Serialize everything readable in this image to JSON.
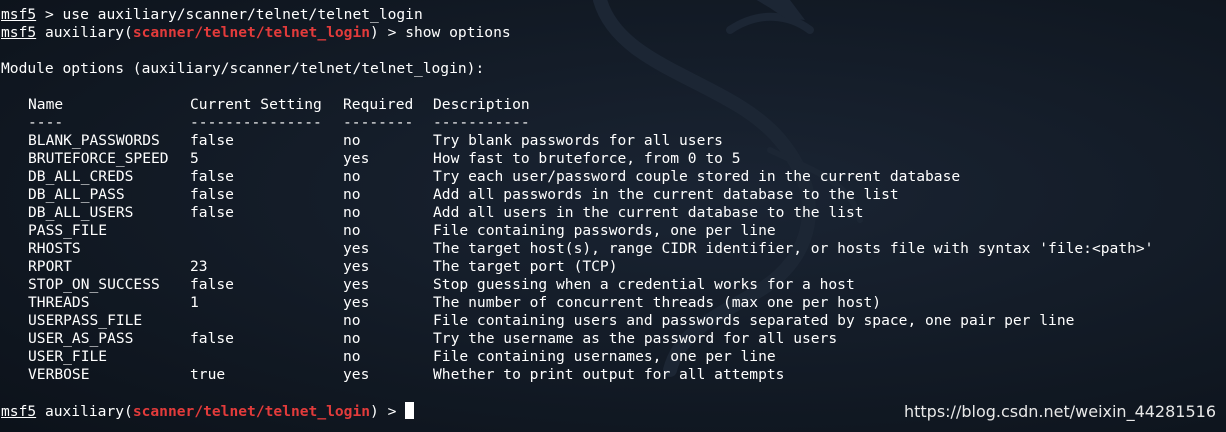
{
  "terminal": {
    "prompt": "msf5",
    "line1_command": " > use auxiliary/scanner/telnet/telnet_login",
    "module_prefix": " auxiliary(",
    "module_name": "scanner/telnet/telnet_login",
    "module_suffix": ") > ",
    "line2_command": "show options",
    "module_options_header": "Module options (auxiliary/scanner/telnet/telnet_login):",
    "columns": [
      "Name",
      "Current Setting",
      "Required",
      "Description"
    ],
    "separators": [
      "----",
      "---------------",
      "--------",
      "-----------"
    ],
    "rows": [
      {
        "name": "BLANK_PASSWORDS",
        "setting": "false",
        "required": "no",
        "description": "Try blank passwords for all users"
      },
      {
        "name": "BRUTEFORCE_SPEED",
        "setting": "5",
        "required": "yes",
        "description": "How fast to bruteforce, from 0 to 5"
      },
      {
        "name": "DB_ALL_CREDS",
        "setting": "false",
        "required": "no",
        "description": "Try each user/password couple stored in the current database"
      },
      {
        "name": "DB_ALL_PASS",
        "setting": "false",
        "required": "no",
        "description": "Add all passwords in the current database to the list"
      },
      {
        "name": "DB_ALL_USERS",
        "setting": "false",
        "required": "no",
        "description": "Add all users in the current database to the list"
      },
      {
        "name": "PASS_FILE",
        "setting": "",
        "required": "no",
        "description": "File containing passwords, one per line"
      },
      {
        "name": "RHOSTS",
        "setting": "",
        "required": "yes",
        "description": "The target host(s), range CIDR identifier, or hosts file with syntax 'file:<path>'"
      },
      {
        "name": "RPORT",
        "setting": "23",
        "required": "yes",
        "description": "The target port (TCP)"
      },
      {
        "name": "STOP_ON_SUCCESS",
        "setting": "false",
        "required": "yes",
        "description": "Stop guessing when a credential works for a host"
      },
      {
        "name": "THREADS",
        "setting": "1",
        "required": "yes",
        "description": "The number of concurrent threads (max one per host)"
      },
      {
        "name": "USERPASS_FILE",
        "setting": "",
        "required": "no",
        "description": "File containing users and passwords separated by space, one pair per line"
      },
      {
        "name": "USER_AS_PASS",
        "setting": "false",
        "required": "no",
        "description": "Try the username as the password for all users"
      },
      {
        "name": "USER_FILE",
        "setting": "",
        "required": "no",
        "description": "File containing usernames, one per line"
      },
      {
        "name": "VERBOSE",
        "setting": "true",
        "required": "yes",
        "description": "Whether to print output for all attempts"
      }
    ]
  },
  "watermark": "https://blog.csdn.net/weixin_44281516",
  "colors": {
    "module_red": "#e23b3b",
    "background": "#111a25",
    "text": "#ffffff"
  },
  "icons": {
    "background_art": "kali-dragon-icon"
  }
}
